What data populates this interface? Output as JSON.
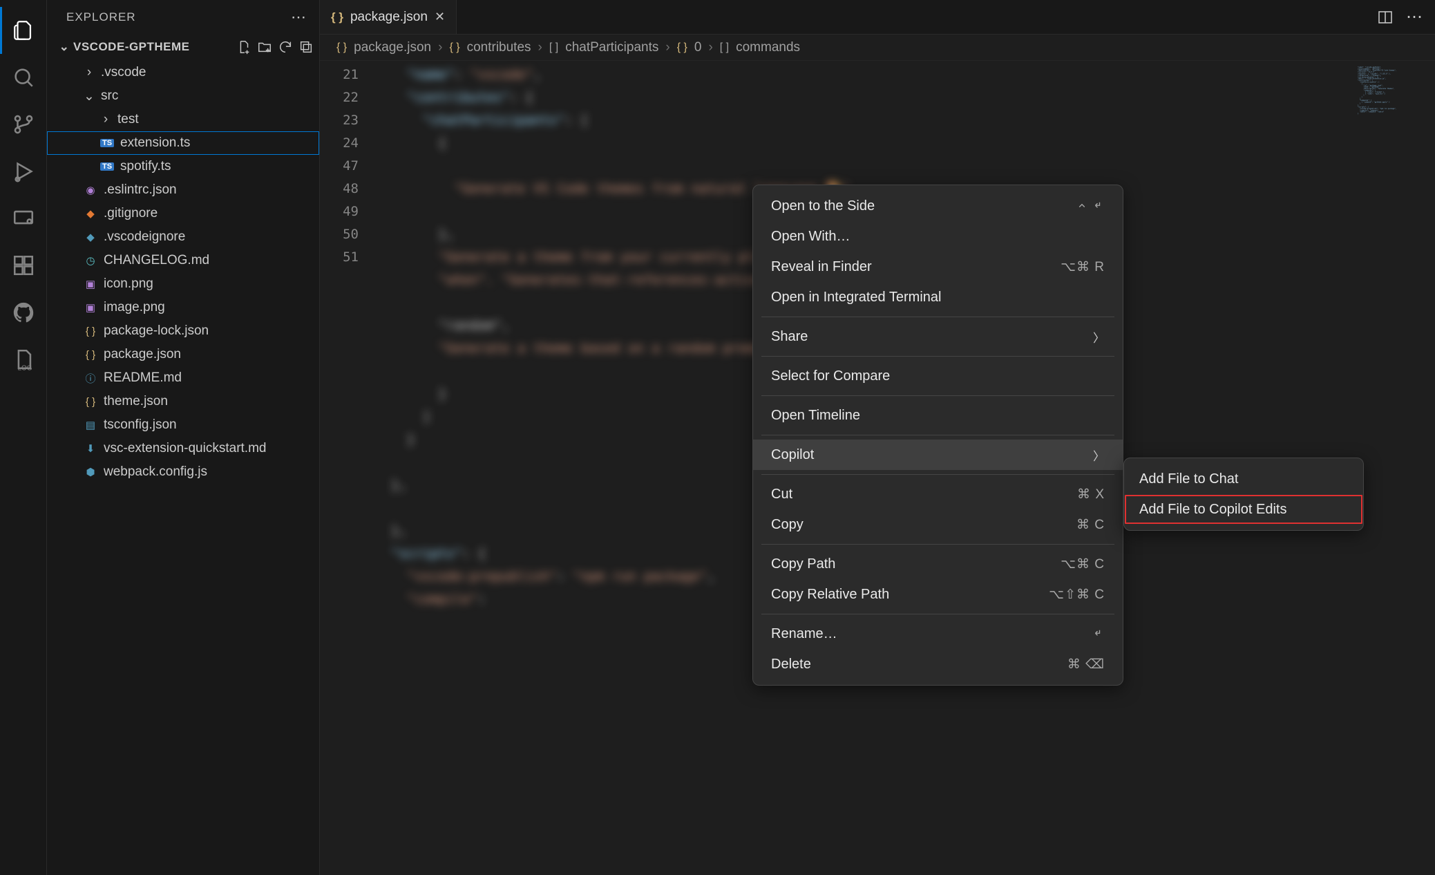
{
  "sidebar": {
    "title": "EXPLORER",
    "folder": "VSCODE-GPTHEME",
    "tree": {
      "vscode": ".vscode",
      "src": "src",
      "test": "test",
      "extension": "extension.ts",
      "spotify": "spotify.ts",
      "eslintrc": ".eslintrc.json",
      "gitignore": ".gitignore",
      "vscodeignore": ".vscodeignore",
      "changelog": "CHANGELOG.md",
      "iconpng": "icon.png",
      "imagepng": "image.png",
      "pkglock": "package-lock.json",
      "pkg": "package.json",
      "readme": "README.md",
      "theme": "theme.json",
      "tsconfig": "tsconfig.json",
      "quickstart": "vsc-extension-quickstart.md",
      "webpack": "webpack.config.js"
    }
  },
  "tab": {
    "name": "package.json"
  },
  "breadcrumb": {
    "b0": "package.json",
    "b1": "contributes",
    "b2": "chatParticipants",
    "b3": "0",
    "b4": "commands"
  },
  "gutter": [
    "21",
    "22",
    "23",
    "24",
    "",
    "",
    "",
    "",
    "",
    "",
    "",
    "",
    "",
    "",
    "",
    "",
    "",
    "",
    "",
    "47",
    "48",
    "",
    "49",
    "50",
    "51"
  ],
  "context_menu": {
    "open_side": "Open to the Side",
    "open_with": "Open With…",
    "reveal": "Reveal in Finder",
    "reveal_sc": "⌥⌘ R",
    "terminal": "Open in Integrated Terminal",
    "share": "Share",
    "compare": "Select for Compare",
    "timeline": "Open Timeline",
    "copilot": "Copilot",
    "cut": "Cut",
    "cut_sc": "⌘ X",
    "copy": "Copy",
    "copy_sc": "⌘ C",
    "copypath": "Copy Path",
    "copypath_sc": "⌥⌘ C",
    "copyrelpath": "Copy Relative Path",
    "copyrelpath_sc": "⌥⇧⌘ C",
    "rename": "Rename…",
    "delete": "Delete",
    "delete_sc": "⌘ ⌫"
  },
  "submenu": {
    "chat": "Add File to Chat",
    "edits": "Add File to Copilot Edits"
  }
}
